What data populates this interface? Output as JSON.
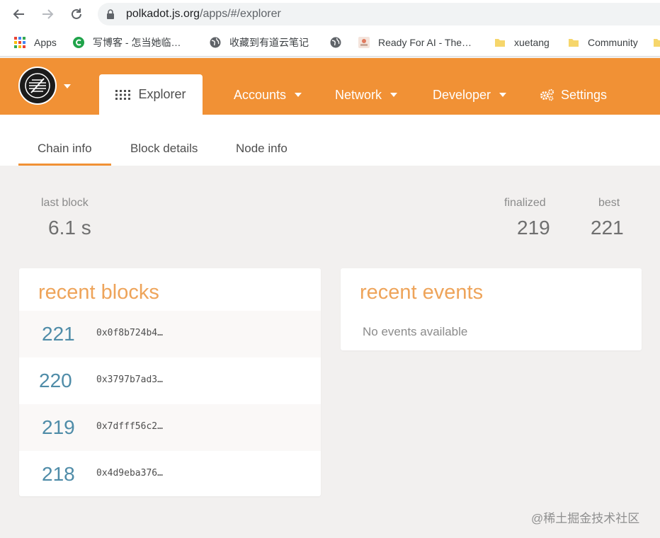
{
  "browser": {
    "url_host": "polkadot.js.org",
    "url_path": "/apps/#/explorer",
    "bookmarks": [
      {
        "label": "Apps",
        "icon": "apps-grid-icon"
      },
      {
        "label": "写博客 - 怎当她临…",
        "icon": "csdn-icon"
      },
      {
        "label": "收藏到有道云笔记",
        "icon": "globe-icon"
      },
      {
        "label": "",
        "icon": "globe-icon"
      },
      {
        "label": "Ready For AI - The…",
        "icon": "ready-icon"
      },
      {
        "label": "xuetang",
        "icon": "folder-icon"
      },
      {
        "label": "Community",
        "icon": "folder-icon"
      }
    ]
  },
  "header": {
    "explorer_label": "Explorer",
    "accounts_label": "Accounts",
    "network_label": "Network",
    "developer_label": "Developer",
    "settings_label": "Settings",
    "accent_color": "#f19135"
  },
  "subtabs": {
    "chain_info": "Chain info",
    "block_details": "Block details",
    "node_info": "Node info"
  },
  "summary": {
    "last_block_label": "last block",
    "last_block_value": "6.1 s",
    "finalized_label": "finalized",
    "finalized_value": "219",
    "best_label": "best",
    "best_value": "221"
  },
  "recent_blocks": {
    "title": "recent blocks",
    "rows": [
      {
        "number": "221",
        "hash": "0x0f8b724b4…"
      },
      {
        "number": "220",
        "hash": "0x3797b7ad3…"
      },
      {
        "number": "219",
        "hash": "0x7dfff56c2…"
      },
      {
        "number": "218",
        "hash": "0x4d9eba376…"
      }
    ]
  },
  "recent_events": {
    "title": "recent events",
    "empty_text": "No events available"
  },
  "watermark": "@稀土掘金技术社区"
}
